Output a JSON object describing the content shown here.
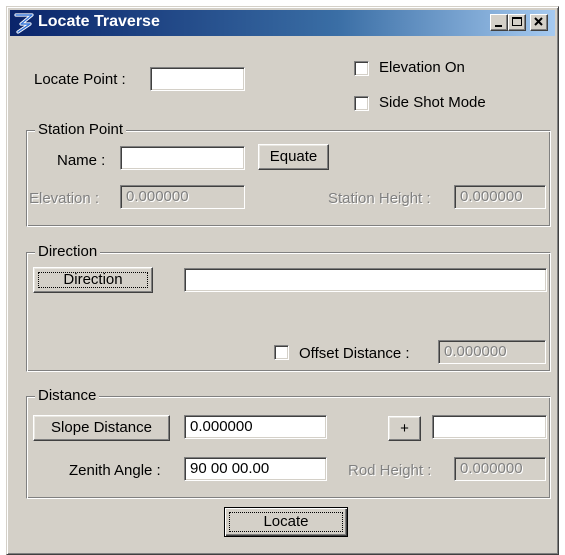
{
  "window": {
    "title": "Locate Traverse",
    "controls": {
      "minimize": "minimize-icon",
      "maximize": "maximize-icon",
      "close": "close-icon"
    }
  },
  "top": {
    "locate_point_label": "Locate Point :",
    "locate_point_value": "",
    "elevation_on_label": "Elevation On",
    "elevation_on_checked": false,
    "side_shot_label": "Side Shot Mode",
    "side_shot_checked": false
  },
  "station_point": {
    "title": "Station Point",
    "name_label": "Name :",
    "name_value": "",
    "equate_label": "Equate",
    "elevation_label": "Elevation :",
    "elevation_value": "0.000000",
    "station_height_label": "Station Height :",
    "station_height_value": "0.000000"
  },
  "direction": {
    "title": "Direction",
    "button_label": "Direction",
    "direction_value": "",
    "offset_label": "Offset Distance :",
    "offset_checked": false,
    "offset_value": "0.000000"
  },
  "distance": {
    "title": "Distance",
    "slope_button_label": "Slope Distance",
    "slope_value": "0.000000",
    "plus_label": "+",
    "plus_value": "",
    "zenith_label": "Zenith Angle :",
    "zenith_value": "90 00 00.00",
    "rod_height_label": "Rod Height :",
    "rod_height_value": "0.000000"
  },
  "footer": {
    "locate_label": "Locate"
  },
  "colors": {
    "face": "#d4d0c8",
    "title_start": "#0a246a",
    "title_end": "#a6caf0",
    "disabled": "#808080"
  }
}
